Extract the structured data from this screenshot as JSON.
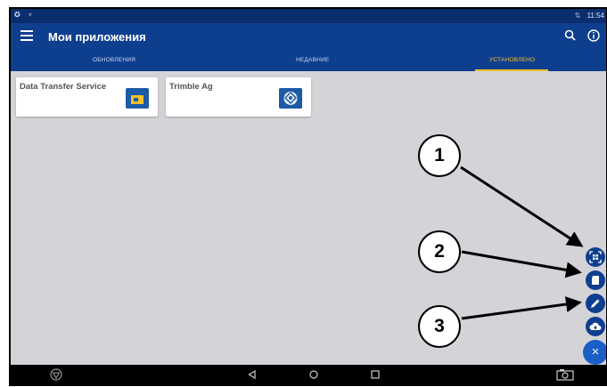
{
  "statusbar": {
    "time": "11:54",
    "signal": "⇅ ",
    "left_icons": "✪ ♆"
  },
  "appbar": {
    "title": "Мои приложения"
  },
  "tabs": [
    {
      "label": "ОБНОВЛЕНИЯ",
      "active": false
    },
    {
      "label": "НЕДАВНИЕ",
      "active": false
    },
    {
      "label": "УСТАНОВЛЕНО",
      "active": true
    }
  ],
  "apps": [
    {
      "name": "Data Transfer Service",
      "icon": "data-transfer-icon"
    },
    {
      "name": "Trimble Ag",
      "icon": "trimble-ag-icon"
    }
  ],
  "callouts": [
    "1",
    "2",
    "3"
  ],
  "fab": {
    "actions": [
      "qr-scan-icon",
      "sd-card-icon",
      "edit-pencil-icon",
      "cloud-upload-icon"
    ],
    "close_label": "×"
  },
  "navbar": {
    "icons": [
      "trimble-logo-icon",
      "back-icon",
      "home-icon",
      "recents-icon",
      "screenshot-camera-icon"
    ]
  },
  "colors": {
    "appbar": "#0e3f8f",
    "statusbar": "#0a2d6e",
    "active_tab": "#f6c12a",
    "background": "#d4d3d8",
    "fab": "#1a5ec7"
  }
}
